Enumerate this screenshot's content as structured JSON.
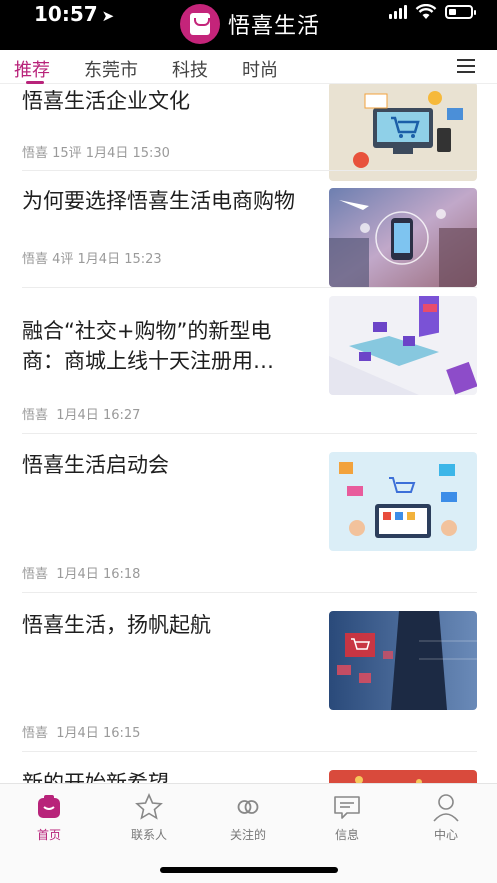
{
  "status_bar": {
    "time": "10:57"
  },
  "app": {
    "title": "悟喜生活"
  },
  "tabs": [
    {
      "label": "推荐"
    },
    {
      "label": "东莞市"
    },
    {
      "label": "科技"
    },
    {
      "label": "时尚"
    }
  ],
  "feed": [
    {
      "title": "悟喜生活企业文化",
      "meta": "悟喜 15评 1月4日 15:30",
      "image": "e-commerce-illustration"
    },
    {
      "title": "为何要选择悟喜生活电商购物",
      "meta": "悟喜 4评 1月4日 15:23",
      "image": "city-shopping-photo"
    },
    {
      "title": "融合“社交+购物”的新型电商：商城上线十天注册用…",
      "meta": "悟喜  1月4日 16:27",
      "image": "isometric-world-map"
    },
    {
      "title": "悟喜生活启动会",
      "meta": "悟喜  1月4日 16:18",
      "image": "tablet-shopping-illustration"
    },
    {
      "title": "悟喜生活，扬帆起航",
      "meta": "悟喜  1月4日 16:15",
      "image": "businessman-cart-screen"
    },
    {
      "title": "新的开始新希望",
      "image": "red-festive"
    }
  ],
  "bottom_nav": [
    {
      "label": "首页",
      "icon": "home-icon"
    },
    {
      "label": "联系人",
      "icon": "star-icon"
    },
    {
      "label": "关注的",
      "icon": "rings-icon"
    },
    {
      "label": "信息",
      "icon": "message-icon"
    },
    {
      "label": "中心",
      "icon": "person-icon"
    }
  ],
  "colors": {
    "accent": "#b8237a",
    "header_bg": "#000000"
  }
}
